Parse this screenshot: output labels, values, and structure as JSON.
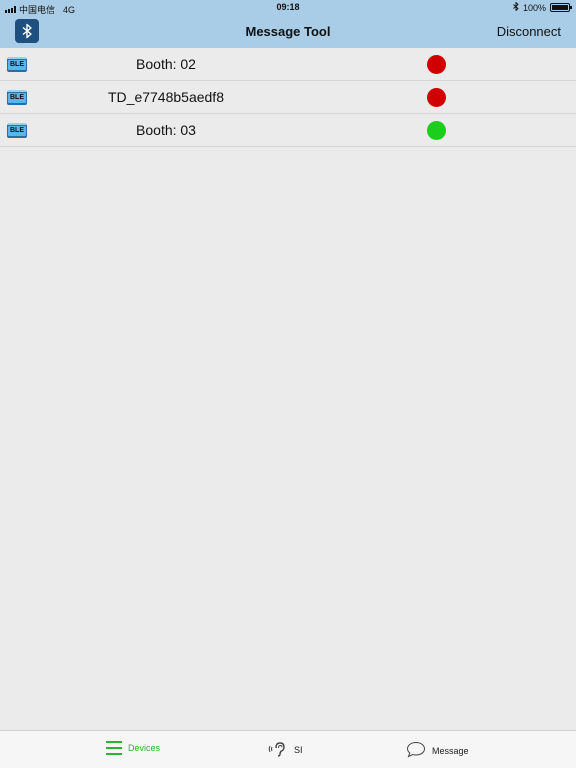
{
  "status_bar": {
    "carrier": "中国电信",
    "network": "4G",
    "time": "09:18",
    "battery_text": "100%",
    "battery_level": 1.0
  },
  "nav_bar": {
    "title": "Message Tool",
    "action_label": "Disconnect",
    "logo_icon": "bluetooth-icon"
  },
  "devices": [
    {
      "icon_text": "BLE",
      "name": "Booth: 02",
      "status_color": "#d10000"
    },
    {
      "icon_text": "BLE",
      "name": "TD_e7748b5aedf8",
      "status_color": "#d10000"
    },
    {
      "icon_text": "BLE",
      "name": "Booth: 03",
      "status_color": "#1ccd1c"
    }
  ],
  "tab_bar": {
    "devices_label": "Devices",
    "si_label": "SI",
    "message_label": "Message",
    "active_color": "#2fb12f"
  }
}
